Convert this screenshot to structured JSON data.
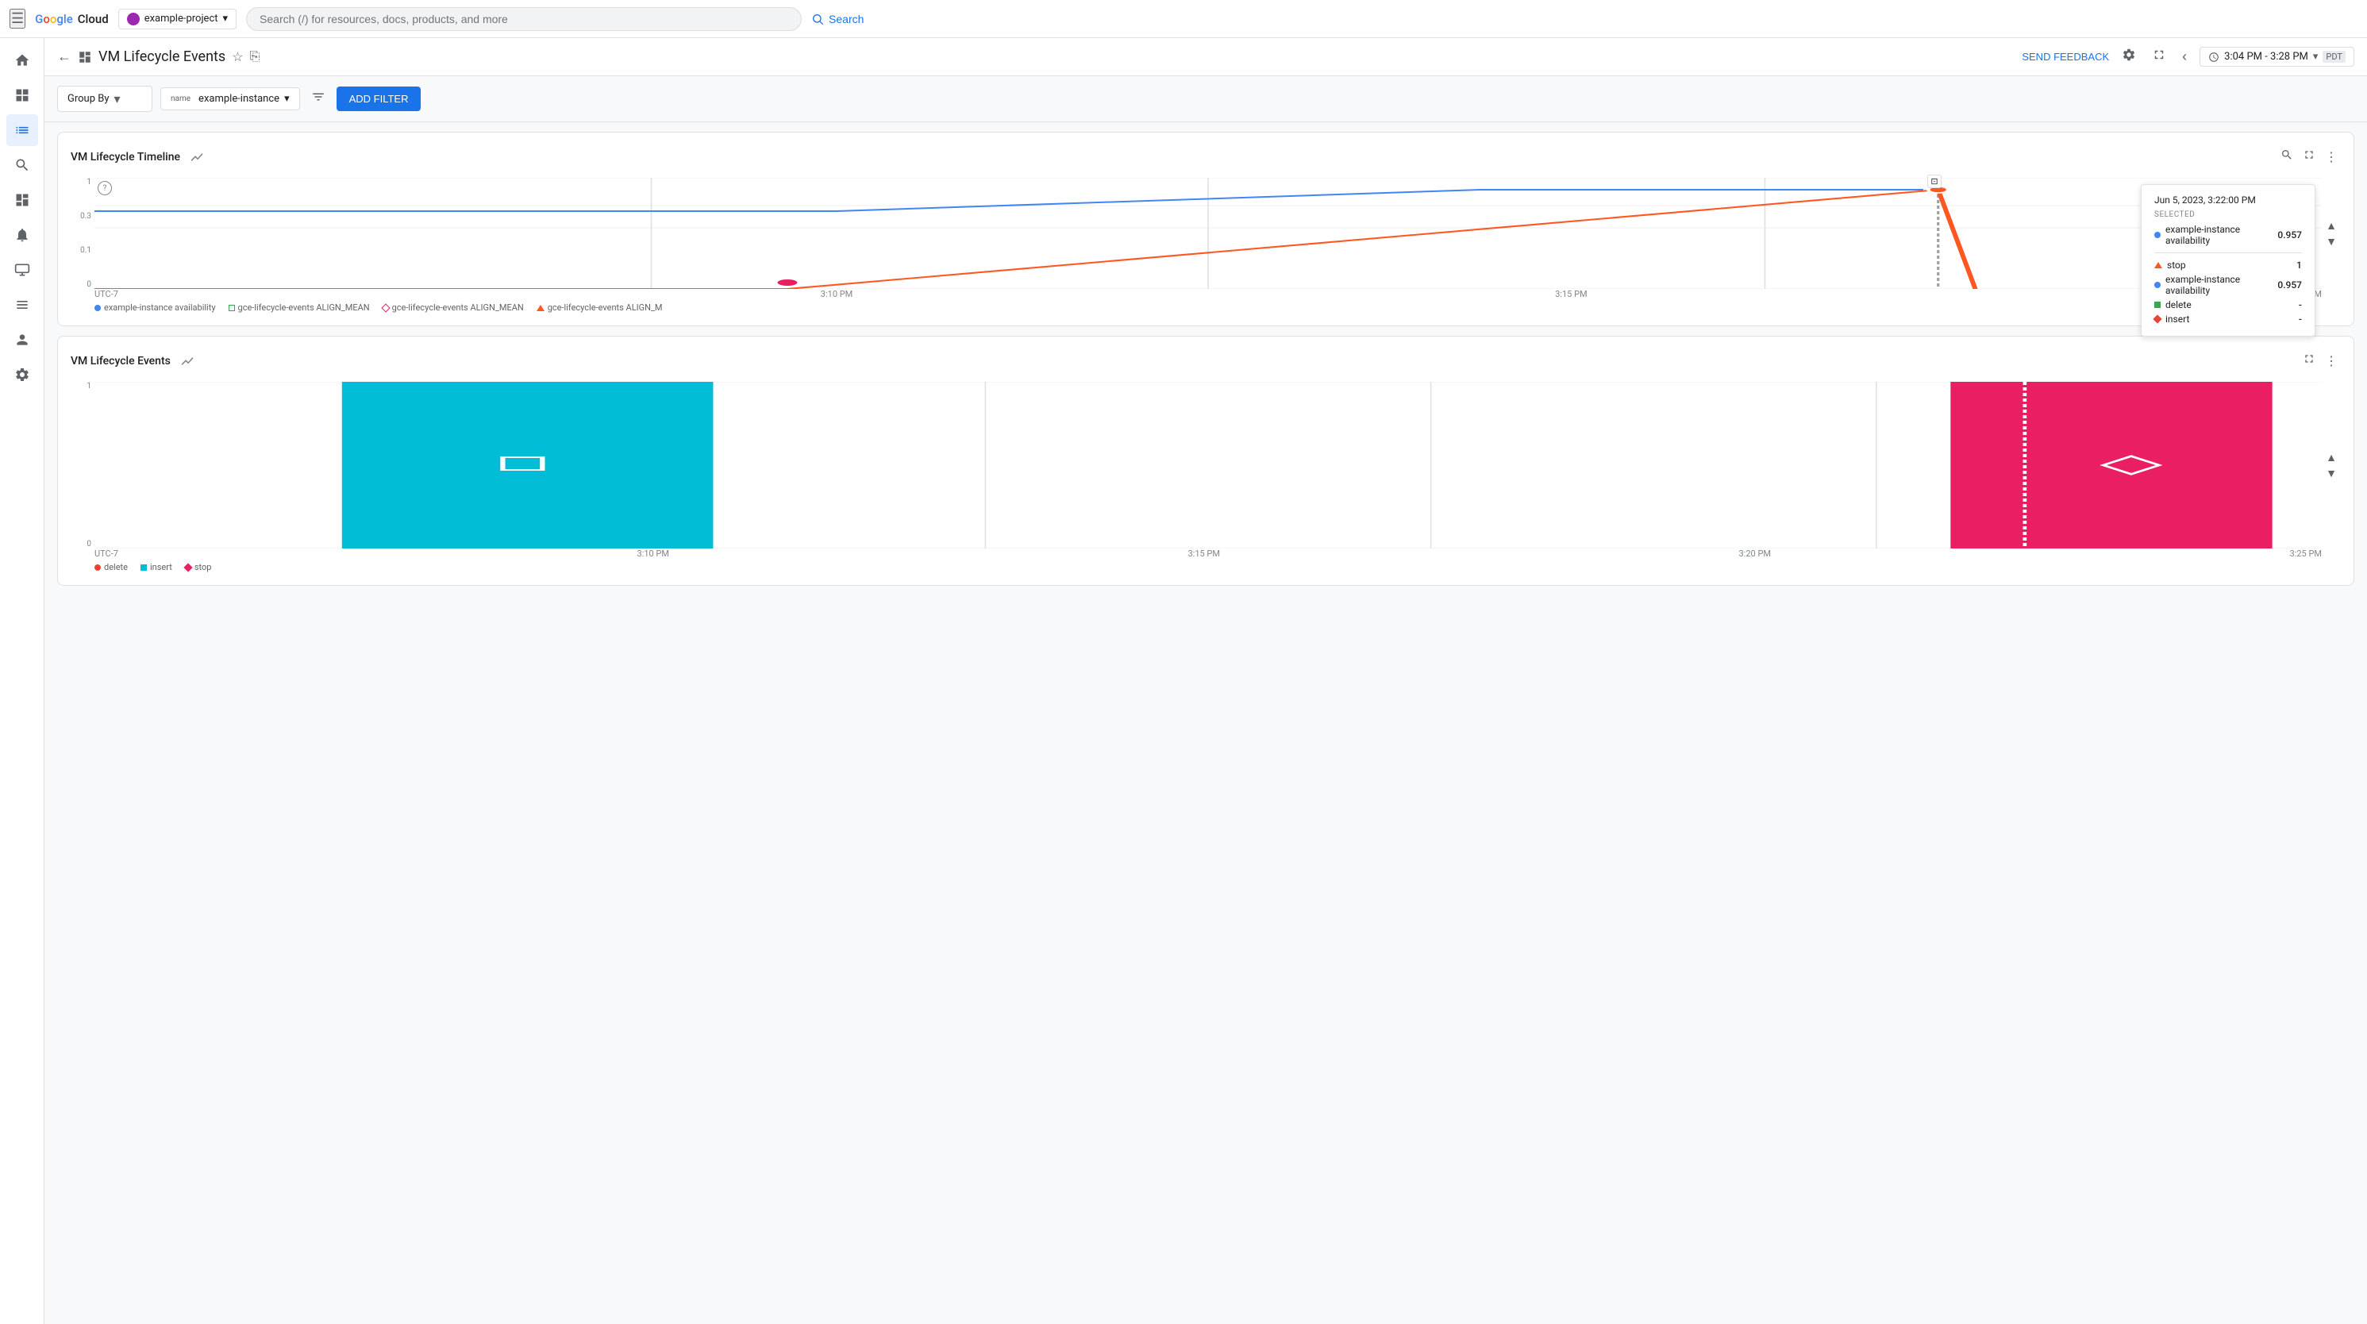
{
  "app": {
    "logo_g": "G",
    "logo_oogle": "oogle",
    "logo_cloud": "Cloud"
  },
  "topnav": {
    "project": "example-project",
    "search_placeholder": "Search (/) for resources, docs, products, and more",
    "search_label": "Search"
  },
  "page": {
    "title": "VM Lifecycle Events",
    "send_feedback": "SEND FEEDBACK",
    "time_range": "3:04 PM - 3:28 PM",
    "timezone": "PDT"
  },
  "filters": {
    "group_by_label": "Group By",
    "name_label": "name",
    "name_value": "example-instance",
    "add_filter_label": "ADD FILTER"
  },
  "chart1": {
    "title": "VM Lifecycle Timeline",
    "y_axis": {
      "top": "1",
      "mid1": "0.3",
      "mid2": "0.1",
      "zero": "0"
    },
    "x_axis": [
      "UTC-7",
      "3:10 PM",
      "3:15 PM",
      "3:20 PM"
    ],
    "legend": [
      {
        "type": "dot",
        "color": "#4285f4",
        "label": "example-instance availability"
      },
      {
        "type": "square",
        "color": "#34a853",
        "label": "gce-lifecycle-events ALIGN_MEAN"
      },
      {
        "type": "diamond",
        "color": "#ea4335",
        "label": "gce-lifecycle-events ALIGN_MEAN"
      },
      {
        "type": "triangle",
        "color": "#ff5722",
        "label": "gce-lifecycle-events ALIGN_M"
      }
    ],
    "tooltip": {
      "date": "Jun 5, 2023, 3:22:00 PM",
      "selected_label": "SELECTED",
      "selected_metric": "example-instance availability",
      "selected_value": "0.957",
      "stop_label": "stop",
      "stop_value": "1",
      "availability_label": "example-instance availability",
      "availability_value": "0.957",
      "delete_label": "delete",
      "delete_value": "-",
      "insert_label": "insert",
      "insert_value": "-"
    }
  },
  "chart2": {
    "title": "VM Lifecycle Events",
    "x_axis": [
      "UTC-7",
      "3:10 PM",
      "3:15 PM",
      "3:20 PM",
      "3:25 PM"
    ],
    "y_axis": {
      "top": "1",
      "bottom": "0"
    },
    "legend": [
      {
        "type": "dot",
        "color": "#ea4335",
        "label": "delete"
      },
      {
        "type": "square",
        "color": "#00bcd4",
        "label": "insert"
      },
      {
        "type": "diamond",
        "color": "#e91e63",
        "label": "stop"
      }
    ]
  },
  "sidebar": {
    "items": [
      {
        "icon": "☰",
        "name": "menu"
      },
      {
        "icon": "◉",
        "name": "home"
      },
      {
        "icon": "📊",
        "name": "dashboard"
      },
      {
        "icon": "👤",
        "name": "user-group"
      },
      {
        "icon": "📈",
        "name": "metrics"
      },
      {
        "icon": "🔍",
        "name": "search-logs"
      },
      {
        "icon": "🔔",
        "name": "alerts"
      },
      {
        "icon": "💻",
        "name": "services"
      },
      {
        "icon": "📦",
        "name": "storage"
      },
      {
        "icon": "👥",
        "name": "iam"
      },
      {
        "icon": "⚙",
        "name": "settings"
      }
    ]
  }
}
